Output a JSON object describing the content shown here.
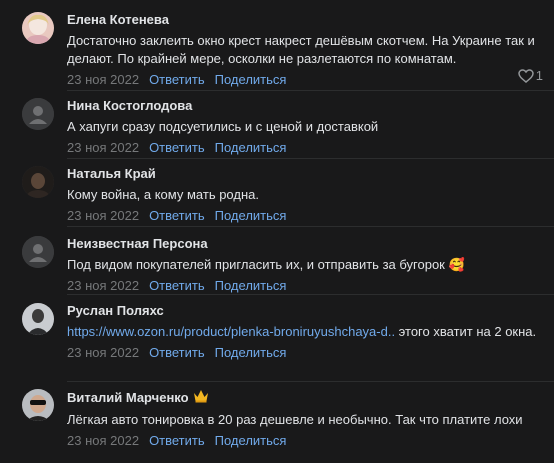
{
  "comments": [
    {
      "author": "Елена Котенева",
      "text": "Достаточно заклеить окно крест накрест дешёвым скотчем. На Украине так и делают. По крайней мере, осколки не разлетаются по комнатам.",
      "date": "23 ноя 2022",
      "reply_label": "Ответить",
      "share_label": "Поделиться",
      "likes": "1",
      "avatar": "photo-avatar-woman"
    },
    {
      "author": "Нина Костоглодова",
      "text": "А хапуги сразу подсуетились и с ценой и доставкой",
      "date": "23 ноя 2022",
      "reply_label": "Ответить",
      "share_label": "Поделиться",
      "avatar": "default-avatar"
    },
    {
      "author": "Наталья Край",
      "text": "Кому война, а кому мать родна.",
      "date": "23 ноя 2022",
      "reply_label": "Ответить",
      "share_label": "Поделиться",
      "avatar": "photo-avatar-dark"
    },
    {
      "author": "Неизвестная Персона",
      "text": "Под видом покупателей пригласить их, и отправить за бугорок 🥰",
      "date": "23 ноя 2022",
      "reply_label": "Ответить",
      "share_label": "Поделиться",
      "avatar": "default-avatar"
    },
    {
      "author": "Руслан Поляхс",
      "link": "https://www.ozon.ru/product/plenka-broniruyushchaya-d..",
      "text": " этого хватит на 2 окна.",
      "date": "23 ноя 2022",
      "reply_label": "Ответить",
      "share_label": "Поделиться",
      "avatar": "photo-avatar-man"
    },
    {
      "author": "Виталий Марченко",
      "badge": "crown-icon",
      "text": "Лёгкая авто тонировка в 20 раз дешевле и необычно. Так что платите лохи",
      "date": "23 ноя 2022",
      "reply_label": "Ответить",
      "share_label": "Поделиться",
      "avatar": "photo-avatar-sunglasses"
    }
  ],
  "colors": {
    "background": "#19191a",
    "text": "#e1e3e6",
    "link": "#71aaeb",
    "secondary": "#76787a"
  }
}
